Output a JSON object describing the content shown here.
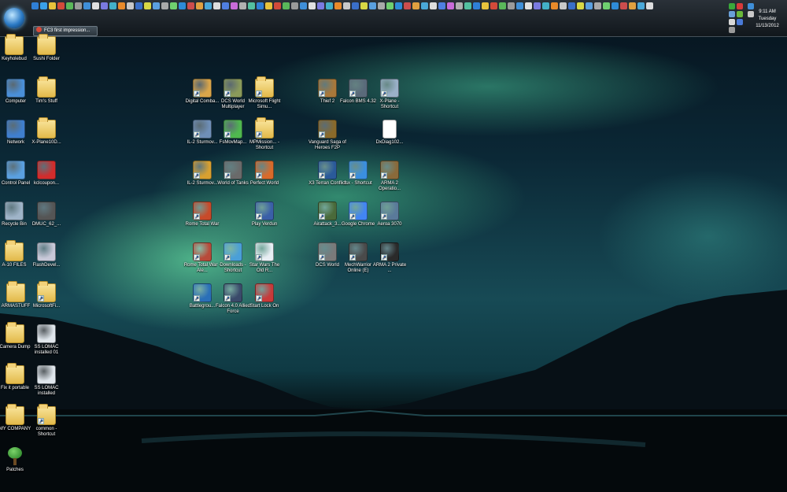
{
  "taskbar": {
    "quicklaunch_colors": [
      "#2f7fd6",
      "#39a0e8",
      "#e8c33c",
      "#d24a3a",
      "#5ab85a",
      "#9a9a9a",
      "#3f8fd8",
      "#e0e0e0",
      "#7a7ae0",
      "#43b0c8",
      "#e88a2a",
      "#c8c8c8",
      "#3a6fc8",
      "#d8d845",
      "#5aa0e0",
      "#a9a9a9",
      "#6fcf6f",
      "#2e8bd8",
      "#cc4d4d",
      "#e0a040",
      "#4aa8d8",
      "#dddddd",
      "#4f7fe0",
      "#c86bd8",
      "#b0b0b0",
      "#53c0a0",
      "#2f7fd6",
      "#e8c33c",
      "#d24a3a",
      "#5ab85a",
      "#9a9a9a",
      "#3f8fd8",
      "#e0e0e0",
      "#7a7ae0",
      "#43b0c8",
      "#e88a2a",
      "#c8c8c8",
      "#3a6fc8",
      "#d8d845",
      "#5aa0e0",
      "#a9a9a9",
      "#6fcf6f",
      "#2e8bd8",
      "#cc4d4d",
      "#e0a040",
      "#4aa8d8",
      "#dddddd",
      "#4f7fe0",
      "#c86bd8",
      "#b0b0b0",
      "#53c0a0",
      "#2f7fd6",
      "#e8c33c",
      "#d24a3a",
      "#5ab85a",
      "#9a9a9a",
      "#3f8fd8",
      "#e0e0e0",
      "#7a7ae0",
      "#43b0c8",
      "#e88a2a",
      "#c8c8c8",
      "#3a6fc8",
      "#d8d845",
      "#5aa0e0",
      "#a9a9a9",
      "#6fcf6f",
      "#2e8bd8",
      "#cc4d4d",
      "#e0a040",
      "#4aa8d8",
      "#dddddd",
      "#4f7fe0",
      "#c86bd8",
      "#b0b0b0",
      "#53c0a0"
    ],
    "task_button": "FC3 first impression...",
    "clock": {
      "time": "9:11 AM",
      "day": "Tuesday",
      "date": "11/13/2012"
    }
  },
  "desktop_icons": [
    {
      "id": "keyholebud",
      "label": "Keyholebud",
      "icon": "folder-icon",
      "color": "#e2b94a",
      "shortcut": false
    },
    {
      "id": "sushi-folder",
      "label": "Sushi Folder",
      "icon": "folder-icon",
      "color": "#e2b94a",
      "shortcut": false
    },
    {
      "id": "computer",
      "label": "Computer",
      "icon": "computer-icon",
      "color": "#4a8fd8",
      "shortcut": false
    },
    {
      "id": "tims-stuff",
      "label": "Tim's Stuff",
      "icon": "folder-icon",
      "color": "#e2b94a",
      "shortcut": false
    },
    {
      "id": "network",
      "label": "Network",
      "icon": "network-icon",
      "color": "#3f7fcf",
      "shortcut": false
    },
    {
      "id": "xplane10",
      "label": "X-Plane10D...",
      "icon": "folder-icon",
      "color": "#e2b94a",
      "shortcut": false
    },
    {
      "id": "control-panel",
      "label": "Control Panel",
      "icon": "control-panel-icon",
      "color": "#5aa0e0",
      "shortcut": false
    },
    {
      "id": "kclcoupon",
      "label": "kclcoupon...",
      "icon": "pdf-icon",
      "color": "#d22c2c",
      "shortcut": false
    },
    {
      "id": "recycle-bin",
      "label": "Recycle Bin",
      "icon": "recycle-bin-icon",
      "color": "#9fb4c8",
      "shortcut": false
    },
    {
      "id": "dmuc",
      "label": "DMUC_62_...",
      "icon": "pilot-icon",
      "color": "#555555",
      "shortcut": false
    },
    {
      "id": "a10-files",
      "label": "A-10 FILES",
      "icon": "folder-icon",
      "color": "#e2b94a",
      "shortcut": false
    },
    {
      "id": "flashdevel",
      "label": "FlashDevel...",
      "icon": "dvd-icon",
      "color": "#c8c8d8",
      "shortcut": false
    },
    {
      "id": "armastuff",
      "label": "ARMASTUFF",
      "icon": "folder-icon",
      "color": "#e2b94a",
      "shortcut": false
    },
    {
      "id": "microsoftfi",
      "label": "MicrosoftFi...",
      "icon": "folder-icon",
      "color": "#e2b94a",
      "shortcut": true
    },
    {
      "id": "camera-dump",
      "label": "Camera Dump",
      "icon": "folder-icon",
      "color": "#e2b94a",
      "shortcut": false
    },
    {
      "id": "ss-lomac-01",
      "label": "SS LOMAC installed 01",
      "icon": "screenshot-icon",
      "color": "#dfe6ec",
      "shortcut": false
    },
    {
      "id": "fix-it-portable",
      "label": "Fix it portable",
      "icon": "folder-icon",
      "color": "#e2b94a",
      "shortcut": false
    },
    {
      "id": "ss-lomac",
      "label": "SS LOMAC installed",
      "icon": "screenshot-icon",
      "color": "#dfe6ec",
      "shortcut": false
    },
    {
      "id": "my-company",
      "label": "MY COMPANY",
      "icon": "folder-icon",
      "color": "#e2b94a",
      "shortcut": false
    },
    {
      "id": "common-shortcut",
      "label": "common - Shortcut",
      "icon": "folder-icon",
      "color": "#e2b94a",
      "shortcut": true
    },
    {
      "id": "patches",
      "label": "Patches",
      "icon": "tree-icon",
      "color": "#2e9a2e",
      "shortcut": false
    },
    {
      "id": "digital-combat",
      "label": "Digital Comba...",
      "icon": "game-icon",
      "color": "#d9a54a",
      "shortcut": true
    },
    {
      "id": "dcs-world-mp",
      "label": "DCS World Multiplayer",
      "icon": "game-icon",
      "color": "#8a9a5a",
      "shortcut": true
    },
    {
      "id": "ms-flight-sim",
      "label": "Microsoft Flight Simu...",
      "icon": "folder-icon",
      "color": "#e2b94a",
      "shortcut": true
    },
    {
      "id": "il2-sturmovik",
      "label": "IL-2 Sturmov...",
      "icon": "game-icon",
      "color": "#6f8fb8",
      "shortcut": true
    },
    {
      "id": "fsmovmap",
      "label": "FsMovMap...",
      "icon": "game-icon",
      "color": "#4fb84f",
      "shortcut": true
    },
    {
      "id": "mpmission",
      "label": "MPMission... - Shortcut",
      "icon": "folder-icon",
      "color": "#e2b94a",
      "shortcut": true
    },
    {
      "id": "il2-sturmovik-2",
      "label": "IL-2 Sturmov...",
      "icon": "game-icon",
      "color": "#d8a030",
      "shortcut": true
    },
    {
      "id": "world-of-tanks",
      "label": "World of Tanks",
      "icon": "game-icon",
      "color": "#6a6a6a",
      "shortcut": true
    },
    {
      "id": "perfect-world",
      "label": "Perfect World",
      "icon": "game-icon",
      "color": "#d86a2a",
      "shortcut": true
    },
    {
      "id": "rome-total-war",
      "label": "Rome Total War",
      "icon": "game-icon",
      "color": "#c84a2a",
      "shortcut": true
    },
    {
      "id": "play-verdun",
      "label": "Play Verdun",
      "icon": "game-icon",
      "color": "#3a5fa8",
      "shortcut": true
    },
    {
      "id": "rome-total-war-alex",
      "label": "Rome Total War - Ale...",
      "icon": "game-icon",
      "color": "#b84a3a",
      "shortcut": true
    },
    {
      "id": "downloads-shortcut",
      "label": "Downloads - Shortcut",
      "icon": "downloads-icon",
      "color": "#4a9fd8",
      "shortcut": true
    },
    {
      "id": "star-wars",
      "label": "Star Wars The Old R...",
      "icon": "calendar-icon",
      "color": "#e8eef4",
      "shortcut": true
    },
    {
      "id": "battlegrounds",
      "label": "Battlegrou...",
      "icon": "game-icon",
      "color": "#2a6fb8",
      "shortcut": true
    },
    {
      "id": "falcon-alliedforce",
      "label": "Falcon 4.0 Allied Force",
      "icon": "game-icon",
      "color": "#3a4a6a",
      "shortcut": true
    },
    {
      "id": "start-lock-on",
      "label": "Start Lock On",
      "icon": "game-icon",
      "color": "#c83a3a",
      "shortcut": true
    },
    {
      "id": "thief-2",
      "label": "Thief 2",
      "icon": "game-icon",
      "color": "#a8783a",
      "shortcut": true
    },
    {
      "id": "falcon-bms",
      "label": "Falcon BMS 4.32",
      "icon": "game-icon",
      "color": "#5a6a7a",
      "shortcut": true
    },
    {
      "id": "xplane-shortcut",
      "label": "X-Plane - Shortcut",
      "icon": "game-icon",
      "color": "#9ab0c8",
      "shortcut": true
    },
    {
      "id": "vanguard",
      "label": "Vanguard Saga of Heroes F2P",
      "icon": "game-icon",
      "color": "#8a6a2a",
      "shortcut": true
    },
    {
      "id": "didiag",
      "label": "DxDiag102...",
      "icon": "text-file-icon",
      "color": "#ffffff",
      "shortcut": false
    },
    {
      "id": "x3-terran",
      "label": "X3 Terran Conflict",
      "icon": "game-icon",
      "color": "#2a5a9a",
      "shortcut": true
    },
    {
      "id": "fsx-shortcut",
      "label": "fsx - Shortcut",
      "icon": "game-icon",
      "color": "#3a8fe0",
      "shortcut": true
    },
    {
      "id": "arma2-operation",
      "label": "ARMA 2 Operatio...",
      "icon": "game-icon",
      "color": "#8a6a3a",
      "shortcut": true
    },
    {
      "id": "rfactor-dr",
      "label": "Airattack_3...",
      "icon": "game-icon",
      "color": "#4a6a3a",
      "shortcut": true
    },
    {
      "id": "google-chrome",
      "label": "Google Chrome",
      "icon": "chrome-icon",
      "color": "#4285f4",
      "shortcut": true
    },
    {
      "id": "aerosoft",
      "label": "Aeroa 3070",
      "icon": "game-icon",
      "color": "#5a7a9a",
      "shortcut": true
    },
    {
      "id": "dcs-world",
      "label": "DCS World",
      "icon": "game-icon",
      "color": "#7a7a7a",
      "shortcut": true
    },
    {
      "id": "mechwarrior",
      "label": "MechWarrior Online (E)",
      "icon": "game-icon",
      "color": "#4a4a4a",
      "shortcut": true
    },
    {
      "id": "arma2-private",
      "label": "ARMA 2 Private ...",
      "icon": "game-icon",
      "color": "#2a2a2a",
      "shortcut": true
    }
  ]
}
